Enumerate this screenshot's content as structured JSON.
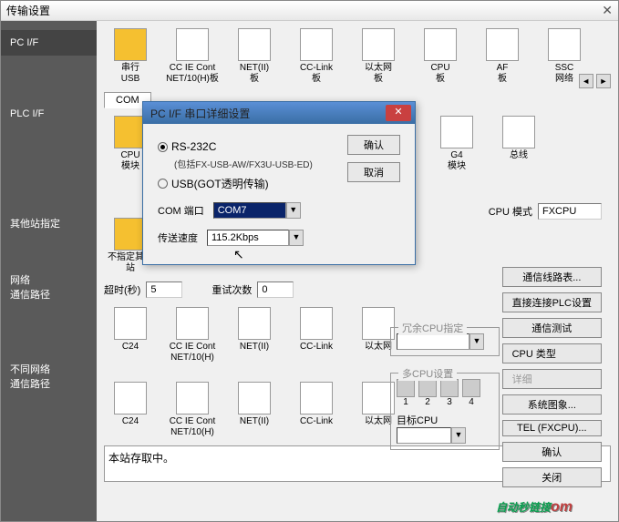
{
  "window": {
    "title": "传输设置",
    "close": "✕"
  },
  "sidebar": {
    "items": [
      {
        "label": "PC I/F"
      },
      {
        "label": "PLC I/F"
      },
      {
        "label": "其他站指定"
      },
      {
        "label": "网络\n通信路径"
      },
      {
        "label": "不同网络\n通信路径"
      }
    ]
  },
  "icon_rows": {
    "row1": [
      {
        "label": "串行\nUSB"
      },
      {
        "label": "CC IE Cont\nNET/10(H)板"
      },
      {
        "label": "NET(II)\n板"
      },
      {
        "label": "CC-Link\n板"
      },
      {
        "label": "以太网\n板"
      },
      {
        "label": "CPU\n板"
      },
      {
        "label": "AF\n板"
      },
      {
        "label": "SSC\n网络"
      }
    ],
    "row2": [
      {
        "label": "CPU\n模块"
      },
      {
        "label": "G4\n模块"
      },
      {
        "label": "总线"
      }
    ],
    "row3": [
      {
        "label": "C24"
      },
      {
        "label": "CC IE Cont\nNET/10(H)"
      },
      {
        "label": "NET(II)"
      },
      {
        "label": "CC-Link"
      },
      {
        "label": "以太网"
      }
    ],
    "row4": [
      {
        "label": "C24"
      },
      {
        "label": "CC IE Cont\nNET/10(H)"
      },
      {
        "label": "NET(II)"
      },
      {
        "label": "CC-Link"
      },
      {
        "label": "以太网"
      }
    ]
  },
  "tabs": {
    "com": "COM"
  },
  "fields": {
    "timeout_label": "超时(秒)",
    "timeout_value": "5",
    "retry_label": "重试次数",
    "retry_value": "0",
    "cpu_mode_label": "CPU 模式",
    "cpu_mode_value": "FXCPU",
    "no_other_station": "不指定其他站"
  },
  "buttons": {
    "comm_route_list": "通信线路表...",
    "direct_plc": "直接连接PLC设置",
    "comm_test": "通信测试",
    "cpu_type": "CPU 类型",
    "detail": "详细",
    "sys_image": "系统图象...",
    "tel": "TEL (FXCPU)...",
    "ok": "确认",
    "close": "关闭"
  },
  "groups": {
    "redundant": "冗余CPU指定",
    "multi_cpu": "多CPU设置",
    "target_cpu": "目标CPU"
  },
  "cpu_nums": [
    "1",
    "2",
    "3",
    "4"
  ],
  "status": {
    "text": "本站存取中。"
  },
  "modal": {
    "title": "PC I/F 串口详细设置",
    "close": "✕",
    "radio_rs232": "RS-232C",
    "radio_rs232_sub": "(包括FX-USB-AW/FX3U-USB-ED)",
    "radio_usb": "USB(GOT透明传输)",
    "btn_ok": "确认",
    "btn_cancel": "取消",
    "com_port_label": "COM 端口",
    "com_port_value": "COM7",
    "baud_label": "传送速度",
    "baud_value": "115.2Kbps"
  },
  "watermark": {
    "text": "自动秒链接",
    "sub": "om"
  }
}
